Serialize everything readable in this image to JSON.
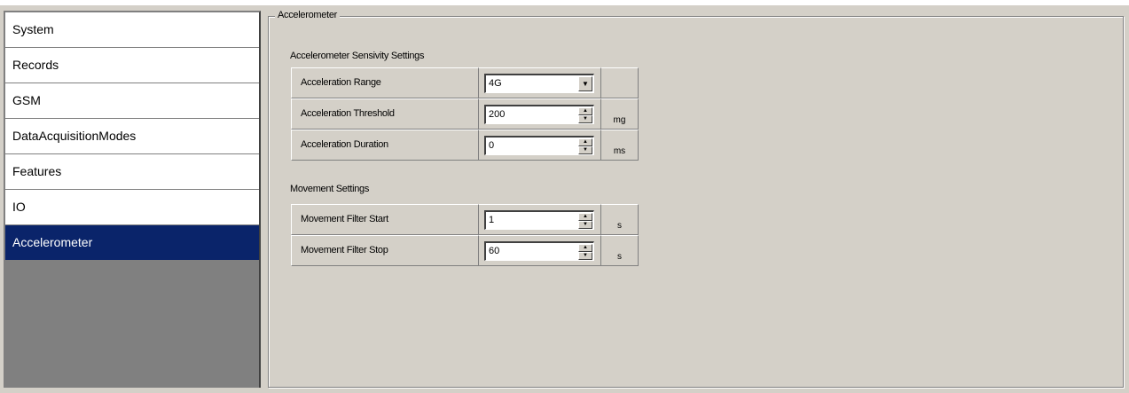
{
  "sidebar": {
    "items": [
      {
        "label": "System",
        "active": false
      },
      {
        "label": "Records",
        "active": false
      },
      {
        "label": "GSM",
        "active": false
      },
      {
        "label": "DataAcquisitionModes",
        "active": false
      },
      {
        "label": "Features",
        "active": false
      },
      {
        "label": "IO",
        "active": false
      },
      {
        "label": "Accelerometer",
        "active": true
      }
    ]
  },
  "panel": {
    "title": "Accelerometer",
    "sensitivity": {
      "title": "Accelerometer Sensivity Settings",
      "rows": [
        {
          "label": "Acceleration Range",
          "value": "4G",
          "unit": "",
          "control": "dropdown"
        },
        {
          "label": "Acceleration Threshold",
          "value": "200",
          "unit": "mg",
          "control": "spinner"
        },
        {
          "label": "Acceleration Duration",
          "value": "0",
          "unit": "ms",
          "control": "spinner"
        }
      ]
    },
    "movement": {
      "title": "Movement Settings",
      "rows": [
        {
          "label": "Movement Filter Start",
          "value": "1",
          "unit": "s",
          "control": "spinner"
        },
        {
          "label": "Movement Filter Stop",
          "value": "60",
          "unit": "s",
          "control": "spinner"
        }
      ]
    }
  },
  "icons": {
    "dropdown": "chevron-down-icon",
    "spin_up": "spin-up-icon",
    "spin_down": "spin-down-icon"
  },
  "colors": {
    "selection": "#0a246a",
    "face": "#d4d0c8",
    "sidebar_bg": "#808080"
  }
}
